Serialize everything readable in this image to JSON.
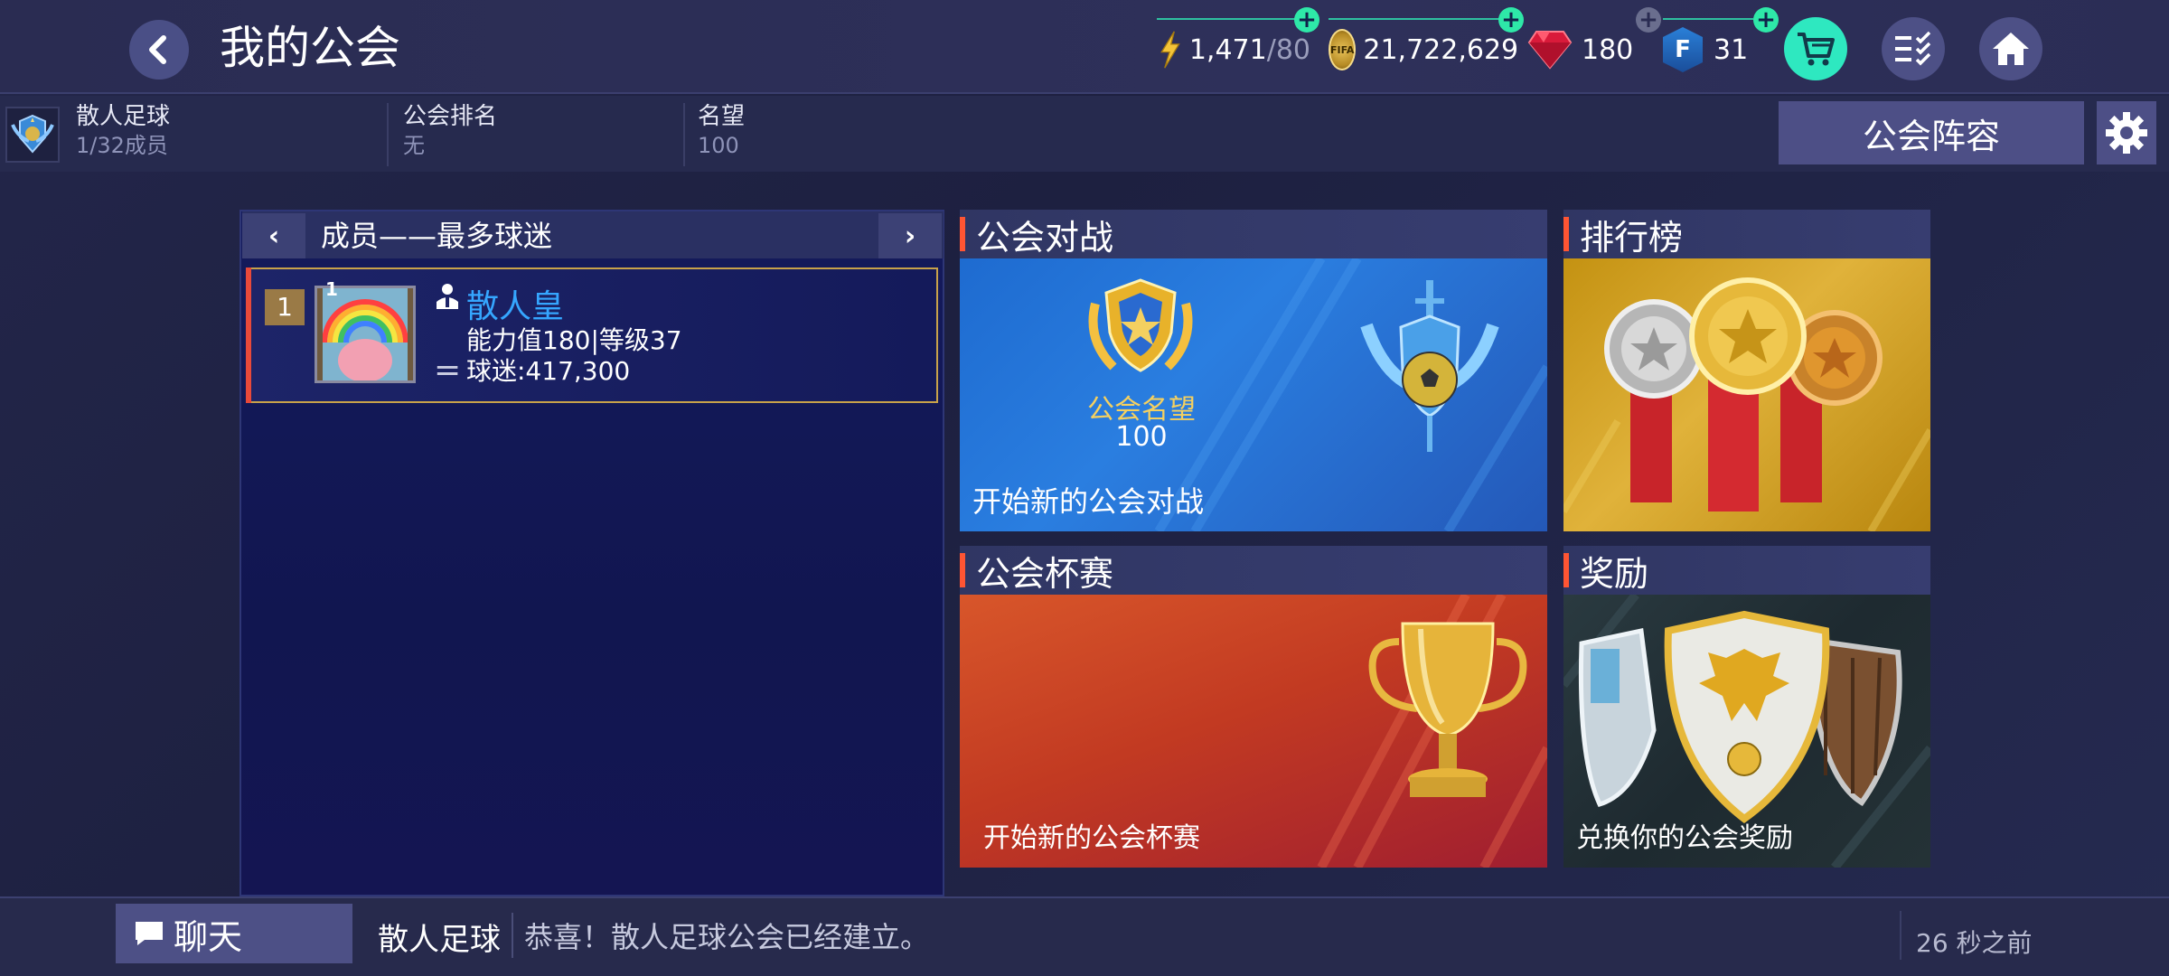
{
  "header": {
    "title": "我的公会"
  },
  "currencies": {
    "energy": {
      "value": "1,471",
      "max": "/80"
    },
    "coins": {
      "value": "21,722,629",
      "badge": "FIFA"
    },
    "gems": {
      "value": "180"
    },
    "fpoints": {
      "value": "31",
      "badge": "F"
    }
  },
  "guild": {
    "name": "散人足球",
    "members": "1/32成员",
    "rank_label": "公会排名",
    "rank_value": "无",
    "prestige_label": "名望",
    "prestige_value": "100",
    "lineup_button": "公会阵容"
  },
  "members_panel": {
    "title": "成员——最多球迷",
    "rows": [
      {
        "rank": "1",
        "name": "散人皇",
        "stats": "能力值180|等级37",
        "fans": "球迷:417,300",
        "avatar_level": "1"
      }
    ]
  },
  "cards": {
    "guild_battle": {
      "title": "公会对战",
      "prestige_label": "公会名望",
      "prestige_value": "100",
      "caption": "开始新的公会对战"
    },
    "leaderboard": {
      "title": "排行榜"
    },
    "guild_cup": {
      "title": "公会杯赛",
      "caption": "开始新的公会杯赛"
    },
    "rewards": {
      "title": "奖励",
      "caption": "兑换你的公会奖励"
    }
  },
  "chat": {
    "button_label": "聊天",
    "sender": "散人足球",
    "message": "恭喜！散人足球公会已经建立。",
    "time": "26 秒之前"
  },
  "colors": {
    "accent_green": "#2ee8a8",
    "link_blue": "#35a6ff",
    "accent_red": "#ff5533"
  }
}
